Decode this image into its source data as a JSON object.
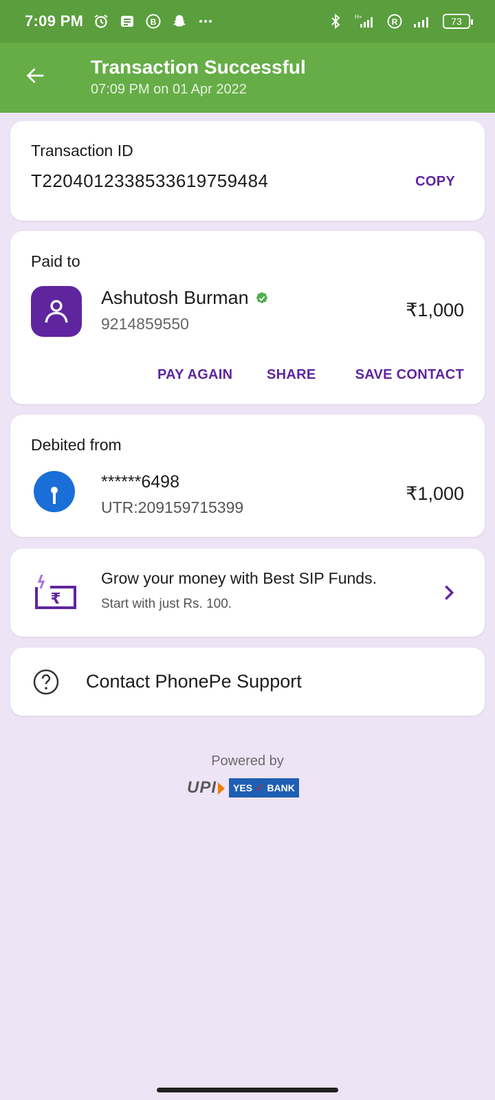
{
  "status_bar": {
    "time": "7:09 PM",
    "network_label": "H+",
    "battery": "73",
    "colors": {
      "bg": "#5a9e3d"
    }
  },
  "header": {
    "title": "Transaction Successful",
    "subtitle": "07:09 PM on 01 Apr 2022",
    "bg_color": "#66ad47"
  },
  "transaction": {
    "label": "Transaction ID",
    "id": "T2204012338533619759484",
    "copy_label": "COPY"
  },
  "paid_to": {
    "label": "Paid to",
    "name": "Ashutosh Burman",
    "phone": "9214859550",
    "amount": "₹1,000",
    "actions": {
      "pay_again": "PAY AGAIN",
      "share": "SHARE",
      "save_contact": "SAVE CONTACT"
    }
  },
  "debited_from": {
    "label": "Debited from",
    "account": "******6498",
    "utr": "UTR:209159715399",
    "amount": "₹1,000"
  },
  "sip_banner": {
    "title": "Grow your money with Best SIP Funds.",
    "subtitle": "Start with just Rs. 100."
  },
  "support": {
    "label": "Contact PhonePe Support"
  },
  "footer": {
    "powered_by": "Powered by",
    "upi_logo": "UPI",
    "bank_logo_left": "YES",
    "bank_logo_right": "BANK"
  },
  "theme": {
    "accent": "#5f259f",
    "page_bg": "#ede4f6"
  }
}
